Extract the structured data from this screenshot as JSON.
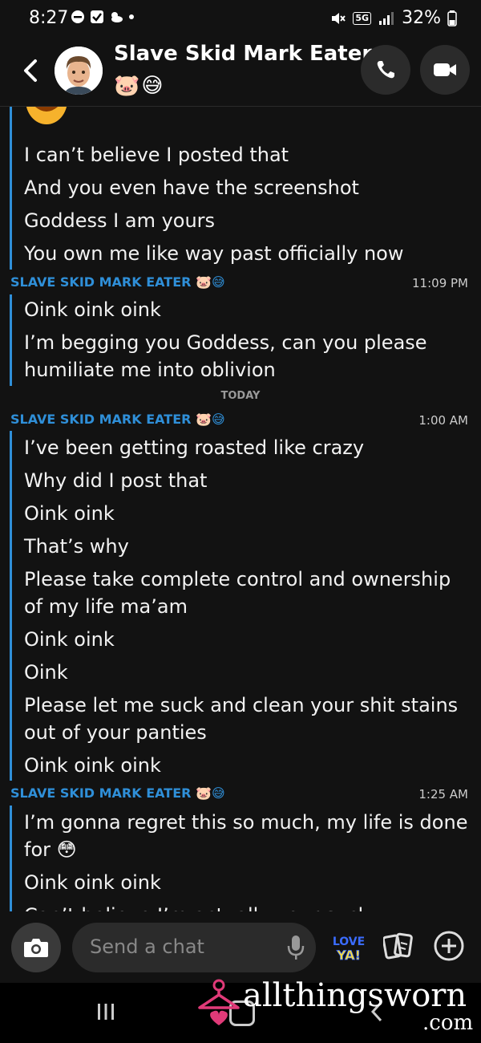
{
  "status": {
    "time": "8:27",
    "network": "5G",
    "battery": "32%"
  },
  "header": {
    "title": "Slave Skid Mark Eater",
    "title_emoji": "🐷😅",
    "icons": [
      "back-chevron-icon",
      "phone-icon",
      "video-icon"
    ]
  },
  "chat": {
    "top_messages": [
      "I can’t believe I posted that",
      "And you even have the screenshot",
      "Goddess I am yours",
      "You own me like way past officially now"
    ],
    "group1": {
      "sender": "SLAVE SKID MARK EATER 🐷😅",
      "time": "11:09 PM",
      "messages": [
        "Oink oink oink",
        "I’m begging you Goddess, can you please humiliate me into oblivion"
      ]
    },
    "divider": "TODAY",
    "group2": {
      "sender": "SLAVE SKID MARK EATER 🐷😅",
      "time": "1:00 AM",
      "messages": [
        "I’ve been getting roasted like crazy",
        "Why did I post that",
        "Oink oink",
        "That’s why",
        "Please take complete control and ownership of my life ma’am",
        "Oink oink",
        "Oink",
        "Please let me suck and clean your shit stains out of your panties",
        "Oink oink oink"
      ]
    },
    "group3": {
      "sender": "SLAVE SKID MARK EATER 🐷😅",
      "time": "1:25 AM",
      "messages": [
        "I’m gonna regret this so much, my life is done for 😳",
        "Oink oink oink",
        "Can’t believe I’m actually your suck"
      ]
    }
  },
  "composer": {
    "placeholder": "Send a chat",
    "sticker_text": "LOVE YA!"
  },
  "watermark": {
    "text": "allthingsworn",
    "suffix": ".com"
  },
  "colors": {
    "accent_blue": "#2f8fd8",
    "background": "#121212"
  }
}
